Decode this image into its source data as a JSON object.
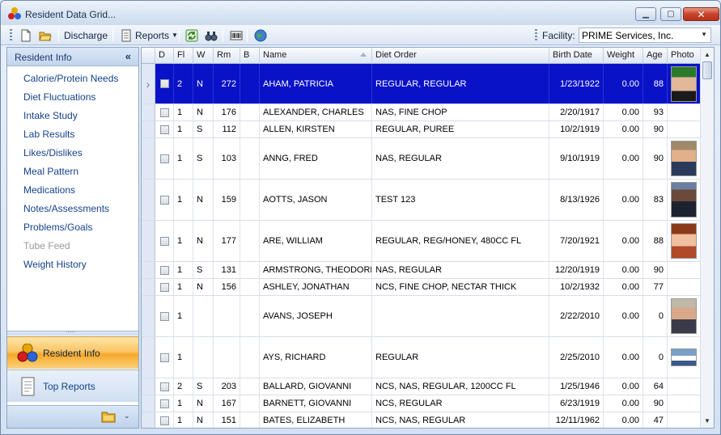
{
  "window": {
    "title": "Resident Data Grid..."
  },
  "toolbar": {
    "discharge_label": "Discharge",
    "reports_label": "Reports",
    "facility_label": "Facility:",
    "facility_value": "PRIME Services, Inc."
  },
  "sidebar": {
    "header": "Resident Info",
    "collapse_glyph": "«",
    "items": [
      {
        "label": "Calorie/Protein Needs",
        "enabled": true
      },
      {
        "label": "Diet Fluctuations",
        "enabled": true
      },
      {
        "label": "Intake Study",
        "enabled": true
      },
      {
        "label": "Lab Results",
        "enabled": true
      },
      {
        "label": "Likes/Dislikes",
        "enabled": true
      },
      {
        "label": "Meal Pattern",
        "enabled": true
      },
      {
        "label": "Medications",
        "enabled": true
      },
      {
        "label": "Notes/Assessments",
        "enabled": true
      },
      {
        "label": "Problems/Goals",
        "enabled": true
      },
      {
        "label": "Tube Feed",
        "enabled": false
      },
      {
        "label": "Weight History",
        "enabled": true
      }
    ],
    "nav_buttons": [
      {
        "label": "Resident Info",
        "active": true
      },
      {
        "label": "Top Reports",
        "active": false
      }
    ]
  },
  "grid": {
    "columns": [
      "D",
      "Fl",
      "W",
      "Rm",
      "B",
      "Name",
      "Diet Order",
      "Birth Date",
      "Weight",
      "Age",
      "Photo"
    ],
    "rows": [
      {
        "fl": "2",
        "w": "N",
        "rm": "272",
        "b": "",
        "name": "AHAM, PATRICIA",
        "diet": "REGULAR, REGULAR",
        "birth": "1/23/1922",
        "weight": "0.00",
        "age": "88",
        "photo": "photo-1",
        "selected": true
      },
      {
        "fl": "1",
        "w": "N",
        "rm": "176",
        "b": "",
        "name": "ALEXANDER, CHARLES",
        "diet": "NAS, FINE CHOP",
        "birth": "2/20/1917",
        "weight": "0.00",
        "age": "93",
        "photo": ""
      },
      {
        "fl": "1",
        "w": "S",
        "rm": "112",
        "b": "",
        "name": "ALLEN, KIRSTEN",
        "diet": "REGULAR, PUREE",
        "birth": "10/2/1919",
        "weight": "0.00",
        "age": "90",
        "photo": ""
      },
      {
        "fl": "1",
        "w": "S",
        "rm": "103",
        "b": "",
        "name": "ANNG, FRED",
        "diet": "NAS, REGULAR",
        "birth": "9/10/1919",
        "weight": "0.00",
        "age": "90",
        "photo": "photo-2"
      },
      {
        "fl": "1",
        "w": "N",
        "rm": "159",
        "b": "",
        "name": "AOTTS, JASON",
        "diet": "TEST 123",
        "birth": "8/13/1926",
        "weight": "0.00",
        "age": "83",
        "photo": "photo-3"
      },
      {
        "fl": "1",
        "w": "N",
        "rm": "177",
        "b": "",
        "name": "ARE, WILLIAM",
        "diet": "REGULAR, REG/HONEY, 480CC FL",
        "birth": "7/20/1921",
        "weight": "0.00",
        "age": "88",
        "photo": "photo-4"
      },
      {
        "fl": "1",
        "w": "S",
        "rm": "131",
        "b": "",
        "name": "ARMSTRONG, THEODORE",
        "diet": "NAS, REGULAR",
        "birth": "12/20/1919",
        "weight": "0.00",
        "age": "90",
        "photo": ""
      },
      {
        "fl": "1",
        "w": "N",
        "rm": "156",
        "b": "",
        "name": "ASHLEY, JONATHAN",
        "diet": "NCS, FINE CHOP, NECTAR THICK",
        "birth": "10/2/1932",
        "weight": "0.00",
        "age": "77",
        "photo": ""
      },
      {
        "fl": "1",
        "w": "",
        "rm": "",
        "b": "",
        "name": "AVANS, JOSEPH",
        "diet": "",
        "birth": "2/22/2010",
        "weight": "0.00",
        "age": "0",
        "photo": "photo-5"
      },
      {
        "fl": "1",
        "w": "",
        "rm": "",
        "b": "",
        "name": "AYS, RICHARD",
        "diet": "REGULAR",
        "birth": "2/25/2010",
        "weight": "0.00",
        "age": "0",
        "photo": "photo-6"
      },
      {
        "fl": "2",
        "w": "S",
        "rm": "203",
        "b": "",
        "name": "BALLARD, GIOVANNI",
        "diet": "NCS, NAS, REGULAR, 1200CC FL",
        "birth": "1/25/1946",
        "weight": "0.00",
        "age": "64",
        "photo": ""
      },
      {
        "fl": "1",
        "w": "N",
        "rm": "167",
        "b": "",
        "name": "BARNETT, GIOVANNI",
        "diet": "NCS, REGULAR",
        "birth": "6/23/1919",
        "weight": "0.00",
        "age": "90",
        "photo": ""
      },
      {
        "fl": "1",
        "w": "N",
        "rm": "151",
        "b": "",
        "name": "BATES, ELIZABETH",
        "diet": "NCS, NAS, REGULAR",
        "birth": "12/11/1962",
        "weight": "0.00",
        "age": "47",
        "photo": ""
      }
    ]
  },
  "colors": {
    "selected_row": "#0a12c8",
    "link_text": "#15428b",
    "active_nav": "#f6a92a"
  }
}
